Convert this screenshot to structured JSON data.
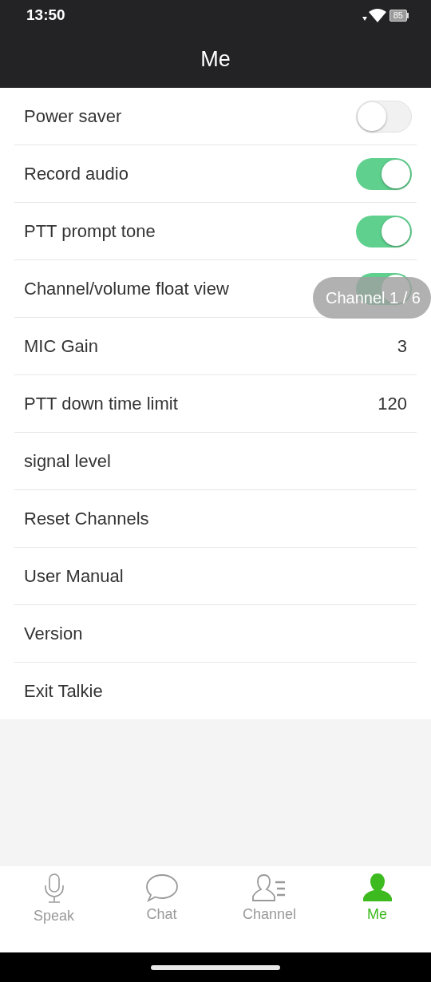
{
  "status_bar": {
    "time": "13:50",
    "battery": "85"
  },
  "header": {
    "title": "Me"
  },
  "settings": [
    {
      "kind": "toggle",
      "label": "Power saver",
      "on": false
    },
    {
      "kind": "toggle",
      "label": "Record audio",
      "on": true
    },
    {
      "kind": "toggle",
      "label": "PTT prompt tone",
      "on": true
    },
    {
      "kind": "toggle",
      "label": "Channel/volume float view",
      "on": true
    },
    {
      "kind": "value",
      "label": "MIC Gain",
      "value": "3"
    },
    {
      "kind": "value",
      "label": "PTT down time limit",
      "value": "120"
    },
    {
      "kind": "plain",
      "label": "signal level"
    },
    {
      "kind": "plain",
      "label": "Reset Channels"
    },
    {
      "kind": "plain",
      "label": "User Manual"
    },
    {
      "kind": "plain",
      "label": "Version"
    },
    {
      "kind": "plain",
      "label": "Exit Talkie"
    }
  ],
  "float_view": {
    "text": "Channel 1 / 6"
  },
  "bottom_nav": [
    {
      "kind": "mic",
      "label": "Speak",
      "selected": false
    },
    {
      "kind": "chat",
      "label": "Chat",
      "selected": false
    },
    {
      "kind": "channel",
      "label": "Channel",
      "selected": false
    },
    {
      "kind": "person",
      "label": "Me",
      "selected": true
    }
  ]
}
